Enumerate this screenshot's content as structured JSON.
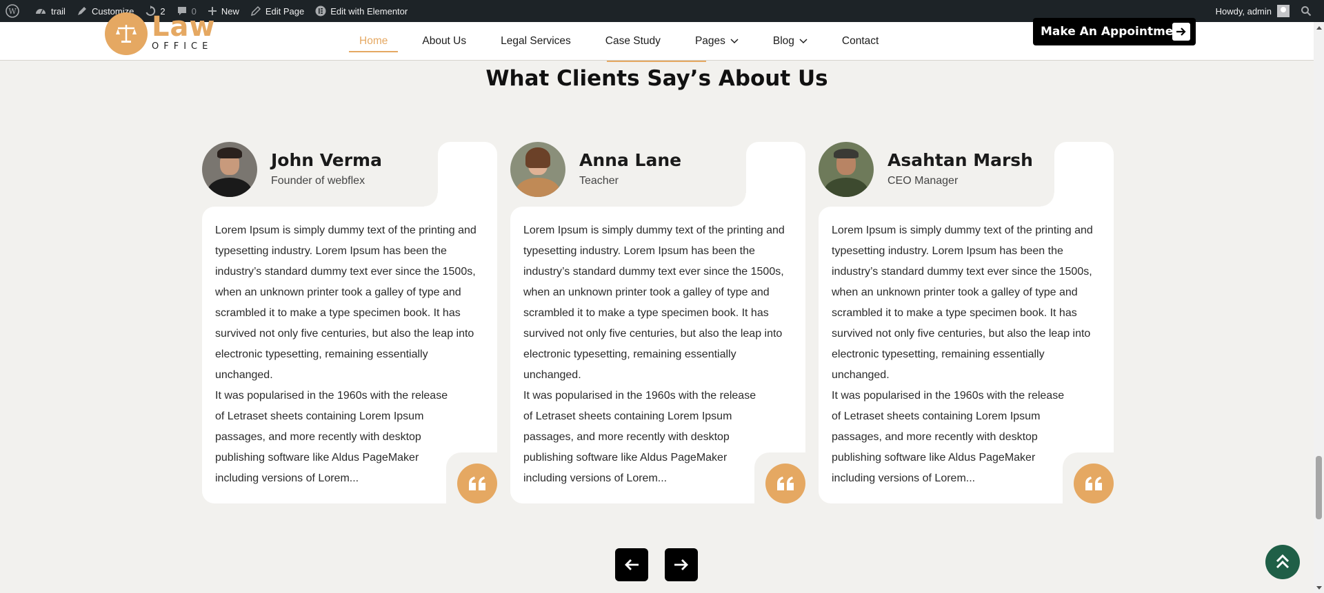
{
  "adminbar": {
    "site_name": "trail",
    "customize": "Customize",
    "updates_count": "2",
    "comments_count": "0",
    "new_label": "New",
    "edit_page": "Edit Page",
    "elementor": "Edit with Elementor",
    "howdy": "Howdy, admin"
  },
  "header": {
    "logo_word": "Law",
    "logo_sub": "OFFICE",
    "nav": [
      "Home",
      "About Us",
      "Legal Services",
      "Case Study",
      "Pages",
      "Blog",
      "Contact"
    ],
    "cta": "Make An Appointment"
  },
  "section": {
    "title": "What Clients Say’s About Us"
  },
  "testimonials": [
    {
      "name": "John Verma",
      "role": "Founder of webflex",
      "text1": "Lorem Ipsum is simply dummy text of the printing and typesetting industry. Lorem Ipsum has been the industry’s standard dummy text ever since the 1500s, when an unknown printer took a galley of type and scrambled it to make a type specimen book. It has survived not only five centuries, but also the leap into electronic typesetting, remaining essentially unchanged.",
      "text2": "It was popularised in the 1960s with the release of Letraset sheets containing Lorem Ipsum passages, and more recently with desktop publishing software like Aldus PageMaker including versions of Lorem..."
    },
    {
      "name": "Anna Lane",
      "role": "Teacher",
      "text1": "Lorem Ipsum is simply dummy text of the printing and typesetting industry. Lorem Ipsum has been the industry’s standard dummy text ever since the 1500s, when an unknown printer took a galley of type and scrambled it to make a type specimen book. It has survived not only five centuries, but also the leap into electronic typesetting, remaining essentially unchanged.",
      "text2": "It was popularised in the 1960s with the release of Letraset sheets containing Lorem Ipsum passages, and more recently with desktop publishing software like Aldus PageMaker including versions of Lorem..."
    },
    {
      "name": "Asahtan Marsh",
      "role": "CEO Manager",
      "text1": "Lorem Ipsum is simply dummy text of the printing and typesetting industry. Lorem Ipsum has been the industry’s standard dummy text ever since the 1500s, when an unknown printer took a galley of type and scrambled it to make a type specimen book. It has survived not only five centuries, but also the leap into electronic typesetting, remaining essentially unchanged.",
      "text2": "It was popularised in the 1960s with the release of Letraset sheets containing Lorem Ipsum passages, and more recently with desktop publishing software like Aldus PageMaker including versions of Lorem..."
    }
  ],
  "colors": {
    "accent": "#e5a862",
    "background": "#f2f1ee",
    "back_to_top": "#1f5f47"
  },
  "icons": [
    "wordpress-icon",
    "dashboard-icon",
    "pencil-icon",
    "updates-icon",
    "comment-icon",
    "plus-icon",
    "edit-icon",
    "elementor-icon",
    "search-icon",
    "scales-icon",
    "chevron-down-icon",
    "arrow-right-icon",
    "quote-icon",
    "arrow-left-icon",
    "double-chevron-up-icon"
  ]
}
